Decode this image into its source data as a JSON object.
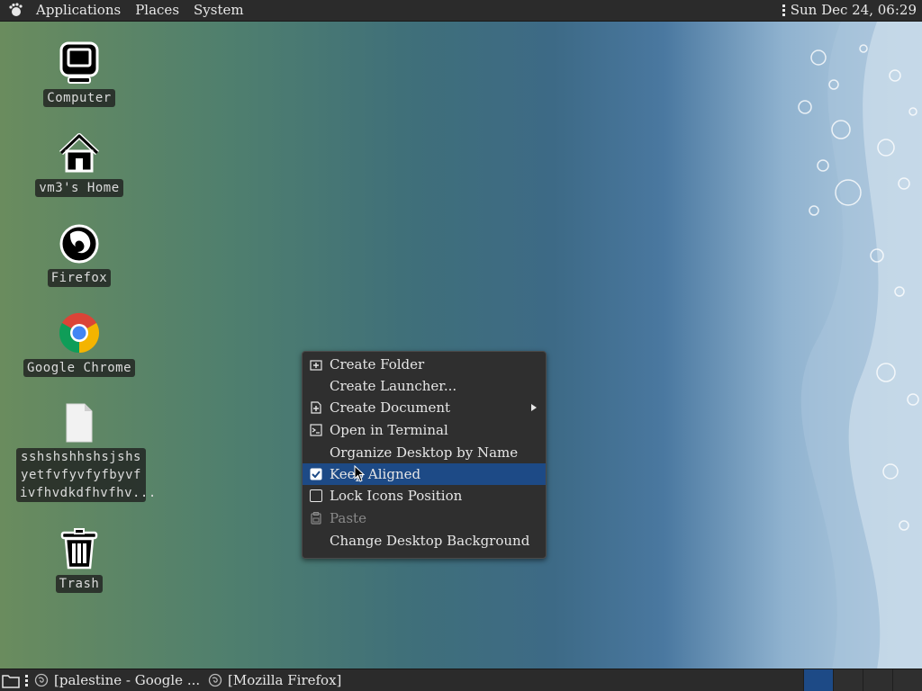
{
  "top_panel": {
    "menus": [
      "Applications",
      "Places",
      "System"
    ],
    "clock": "Sun Dec 24, 06:29"
  },
  "desktop_icons": [
    {
      "label": "Computer",
      "icon": "computer-icon"
    },
    {
      "label": "vm3's Home",
      "icon": "home-icon"
    },
    {
      "label": "Firefox",
      "icon": "firefox-icon"
    },
    {
      "label": "Google Chrome",
      "icon": "chrome-icon"
    },
    {
      "label": "sshshshhshsjshs\nyetfvfyvfyfbyvf\nivfhvdkdfhvfhv...",
      "icon": "file-icon"
    },
    {
      "label": "Trash",
      "icon": "trash-icon"
    }
  ],
  "context_menu": {
    "items": [
      {
        "label": "Create Folder",
        "icon": "folder-add-icon"
      },
      {
        "label": "Create Launcher...",
        "icon": ""
      },
      {
        "label": "Create Document",
        "icon": "document-add-icon",
        "submenu": true
      },
      {
        "label": "Open in Terminal",
        "icon": "terminal-icon"
      },
      {
        "label": "Organize Desktop by Name",
        "icon": ""
      },
      {
        "label": "Keep Aligned",
        "icon": "checkbox-icon",
        "checked": true,
        "highlighted": true
      },
      {
        "label": "Lock Icons Position",
        "icon": "checkbox-icon",
        "checked": false
      },
      {
        "label": "Paste",
        "icon": "paste-icon",
        "disabled": true
      },
      {
        "label": "Change Desktop Background",
        "icon": ""
      }
    ]
  },
  "taskbar": {
    "tasks": [
      "[palestine - Google ...",
      "[Mozilla Firefox]"
    ]
  },
  "colors": {
    "panel": "#2b2b2b",
    "highlight": "#1d4a86"
  }
}
